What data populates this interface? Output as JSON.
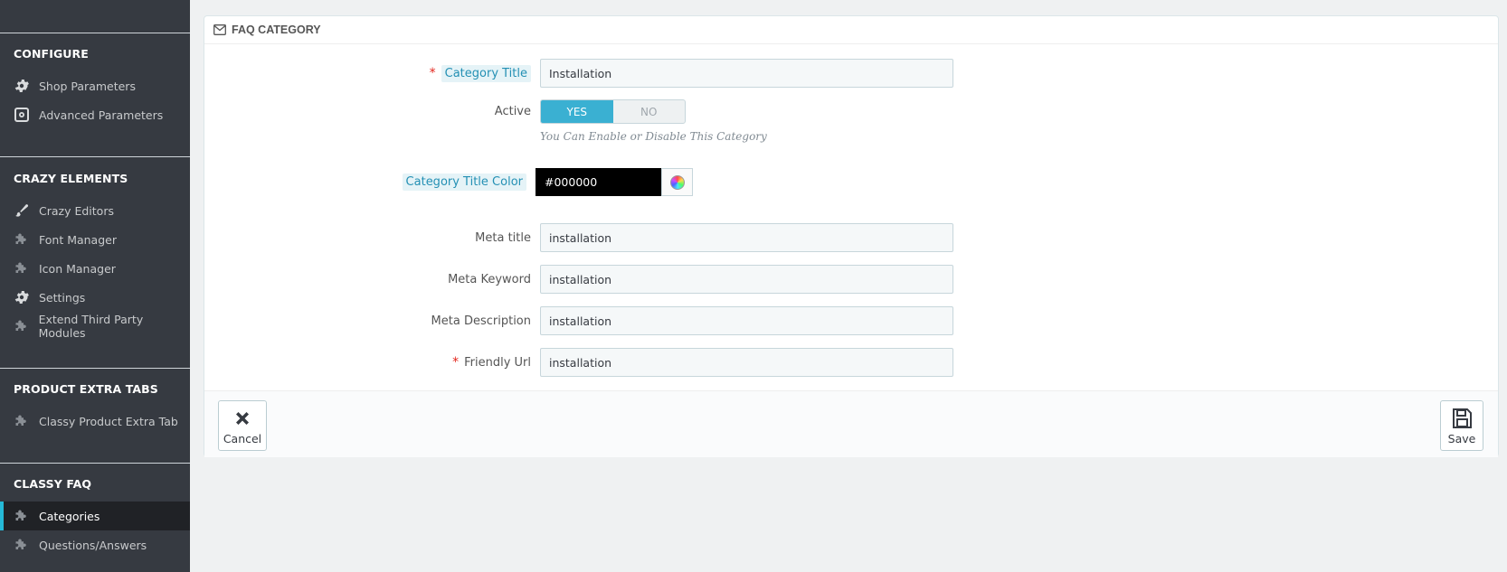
{
  "sidebar": {
    "sections": [
      {
        "title": "CONFIGURE"
      },
      {
        "title": "CRAZY ELEMENTS"
      },
      {
        "title": "PRODUCT EXTRA TABS"
      },
      {
        "title": "CLASSY FAQ"
      }
    ],
    "items": [
      {
        "label": "Shop Parameters",
        "icon": "gear-icon"
      },
      {
        "label": "Advanced Parameters",
        "icon": "settings-box-icon"
      },
      {
        "label": "Crazy Editors",
        "icon": "brush-icon"
      },
      {
        "label": "Font Manager",
        "icon": "puzzle-icon"
      },
      {
        "label": "Icon Manager",
        "icon": "puzzle-icon"
      },
      {
        "label": "Settings",
        "icon": "gear-icon"
      },
      {
        "label": "Extend Third Party Modules",
        "icon": "puzzle-icon"
      },
      {
        "label": "Classy Product Extra Tab",
        "icon": "puzzle-icon"
      },
      {
        "label": "Categories",
        "icon": "puzzle-icon",
        "active": true
      },
      {
        "label": "Questions/Answers",
        "icon": "puzzle-icon"
      }
    ]
  },
  "panel": {
    "heading": "FAQ CATEGORY",
    "heading_icon": "envelope-icon"
  },
  "form": {
    "category_title": {
      "label": "Category Title",
      "value": "Installation",
      "required": "*"
    },
    "active": {
      "label": "Active",
      "yes": "YES",
      "no": "NO",
      "selected": "YES",
      "help": "You Can Enable or Disable This Category"
    },
    "title_color": {
      "label": "Category Title Color",
      "value": "#000000"
    },
    "meta_title": {
      "label": "Meta title",
      "value": "installation"
    },
    "meta_keyword": {
      "label": "Meta Keyword",
      "value": "installation"
    },
    "meta_description": {
      "label": "Meta Description",
      "value": "installation"
    },
    "friendly_url": {
      "label": "Friendly Url",
      "value": "installation",
      "required": "*"
    }
  },
  "footer": {
    "cancel_label": "Cancel",
    "save_label": "Save"
  },
  "colors": {
    "sidebar_bg": "#363a41",
    "accent": "#25b9d7",
    "switch_on": "#3ab0d2",
    "required": "#e3261d"
  }
}
